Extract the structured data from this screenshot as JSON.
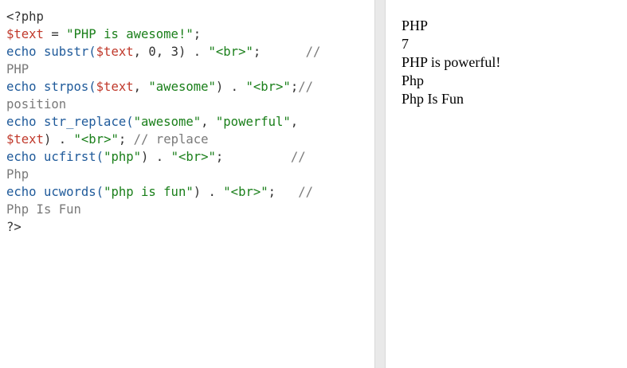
{
  "editor": {
    "lines": [
      [
        {
          "t": "<?php",
          "c": "pun"
        }
      ],
      [
        {
          "t": "$text",
          "c": "var"
        },
        {
          "t": " = ",
          "c": "pun"
        },
        {
          "t": "\"PHP is awesome!\"",
          "c": "str"
        },
        {
          "t": ";",
          "c": "pun"
        }
      ],
      [
        {
          "t": "echo",
          "c": "kw"
        },
        {
          "t": " ",
          "c": "pun"
        },
        {
          "t": "substr(",
          "c": "kw"
        },
        {
          "t": "$text",
          "c": "var"
        },
        {
          "t": ", 0, 3) . ",
          "c": "pun"
        },
        {
          "t": "\"<br>\"",
          "c": "str"
        },
        {
          "t": ";      ",
          "c": "pun"
        },
        {
          "t": "//",
          "c": "cmt"
        }
      ],
      [
        {
          "t": "PHP",
          "c": "cmt"
        }
      ],
      [
        {
          "t": "echo",
          "c": "kw"
        },
        {
          "t": " ",
          "c": "pun"
        },
        {
          "t": "strpos(",
          "c": "kw"
        },
        {
          "t": "$text",
          "c": "var"
        },
        {
          "t": ", ",
          "c": "pun"
        },
        {
          "t": "\"awesome\"",
          "c": "str"
        },
        {
          "t": ") . ",
          "c": "pun"
        },
        {
          "t": "\"<br>\"",
          "c": "str"
        },
        {
          "t": ";",
          "c": "pun"
        },
        {
          "t": "//",
          "c": "cmt"
        }
      ],
      [
        {
          "t": "position",
          "c": "cmt"
        }
      ],
      [
        {
          "t": "echo",
          "c": "kw"
        },
        {
          "t": " ",
          "c": "pun"
        },
        {
          "t": "str_replace(",
          "c": "kw"
        },
        {
          "t": "\"awesome\"",
          "c": "str"
        },
        {
          "t": ", ",
          "c": "pun"
        },
        {
          "t": "\"powerful\"",
          "c": "str"
        },
        {
          "t": ",",
          "c": "pun"
        }
      ],
      [
        {
          "t": "$text",
          "c": "var"
        },
        {
          "t": ") . ",
          "c": "pun"
        },
        {
          "t": "\"<br>\"",
          "c": "str"
        },
        {
          "t": "; ",
          "c": "pun"
        },
        {
          "t": "// replace",
          "c": "cmt"
        }
      ],
      [
        {
          "t": "echo",
          "c": "kw"
        },
        {
          "t": " ",
          "c": "pun"
        },
        {
          "t": "ucfirst(",
          "c": "kw"
        },
        {
          "t": "\"php\"",
          "c": "str"
        },
        {
          "t": ") . ",
          "c": "pun"
        },
        {
          "t": "\"<br>\"",
          "c": "str"
        },
        {
          "t": ";         ",
          "c": "pun"
        },
        {
          "t": "//",
          "c": "cmt"
        }
      ],
      [
        {
          "t": "Php",
          "c": "cmt"
        }
      ],
      [
        {
          "t": "echo",
          "c": "kw"
        },
        {
          "t": " ",
          "c": "pun"
        },
        {
          "t": "ucwords(",
          "c": "kw"
        },
        {
          "t": "\"php is fun\"",
          "c": "str"
        },
        {
          "t": ") . ",
          "c": "pun"
        },
        {
          "t": "\"<br>\"",
          "c": "str"
        },
        {
          "t": ";   ",
          "c": "pun"
        },
        {
          "t": "//",
          "c": "cmt"
        }
      ],
      [
        {
          "t": "Php Is Fun",
          "c": "cmt"
        }
      ],
      [
        {
          "t": "?>",
          "c": "pun"
        }
      ]
    ]
  },
  "output": {
    "lines": [
      "PHP",
      "7",
      "PHP is powerful!",
      "Php",
      "Php Is Fun"
    ]
  },
  "colors": {
    "variable": "#c0392b",
    "string": "#1a7f1a",
    "keyword": "#1f5a9a",
    "comment": "#7a7a7a",
    "plain": "#333333",
    "divider": "#e9e9e9"
  }
}
